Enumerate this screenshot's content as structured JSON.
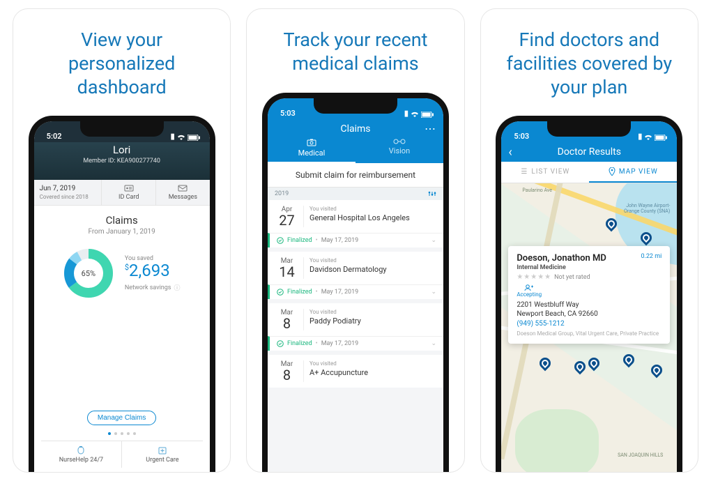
{
  "colors": {
    "accent": "#0a88d1",
    "success": "#1ab77e"
  },
  "card1": {
    "headline": "View your personalized dashboard",
    "status_time": "5:02",
    "user_name": "Lori",
    "member_id": "Member ID: KEA900277740",
    "strip": {
      "date": "Jun 7, 2019",
      "covered": "Covered since 2018",
      "idcard": "ID Card",
      "messages": "Messages"
    },
    "claims": {
      "title": "Claims",
      "subtitle": "From January 1, 2019",
      "donut_percent": "65%",
      "saved_label": "You saved",
      "saved_amount": "2,693",
      "saved_currency": "$",
      "network": "Network savings",
      "manage": "Manage Claims"
    },
    "bottom": {
      "nurse": "NurseHelp 24/7",
      "urgent": "Urgent Care"
    }
  },
  "card2": {
    "headline": "Track your recent medical claims",
    "status_time": "5:03",
    "title": "Claims",
    "tab_medical": "Medical",
    "tab_vision": "Vision",
    "submit": "Submit claim for reimbursement",
    "year": "2019",
    "visited_label": "You visited",
    "finalized_label": "Finalized",
    "items": [
      {
        "month": "Apr",
        "day": "27",
        "provider": "General Hospital Los Angeles",
        "status_date": "May 17, 2019"
      },
      {
        "month": "Mar",
        "day": "14",
        "provider": "Davidson Dermatology",
        "status_date": "May 17, 2019"
      },
      {
        "month": "Mar",
        "day": "8",
        "provider": "Paddy Podiatry",
        "status_date": "May 17, 2019"
      },
      {
        "month": "Mar",
        "day": "8",
        "provider": "A+ Accupuncture",
        "status_date": ""
      }
    ]
  },
  "card3": {
    "headline": "Find doctors and facilities covered by your plan",
    "status_time": "5:03",
    "title": "Doctor Results",
    "list_view": "LIST VIEW",
    "map_view": "MAP VIEW",
    "map_labels": {
      "airport": "John Wayne Airport-Orange County (SNA)",
      "road": "Paularino Ave",
      "park": "SAN JOAQUIN HILLS"
    },
    "doctor": {
      "name": "Doeson, Jonathon MD",
      "distance": "0.22 mi",
      "specialty": "Internal Medicine",
      "rating_text": "Not yet rated",
      "accepting": "Accepting",
      "address1": "2201 Westbluff Way",
      "address2": "Newport Beach, CA 92660",
      "phone": "(949) 555-1212",
      "group": "Doeson Medical Group, Vital Urgent Care, Private Practice"
    }
  }
}
